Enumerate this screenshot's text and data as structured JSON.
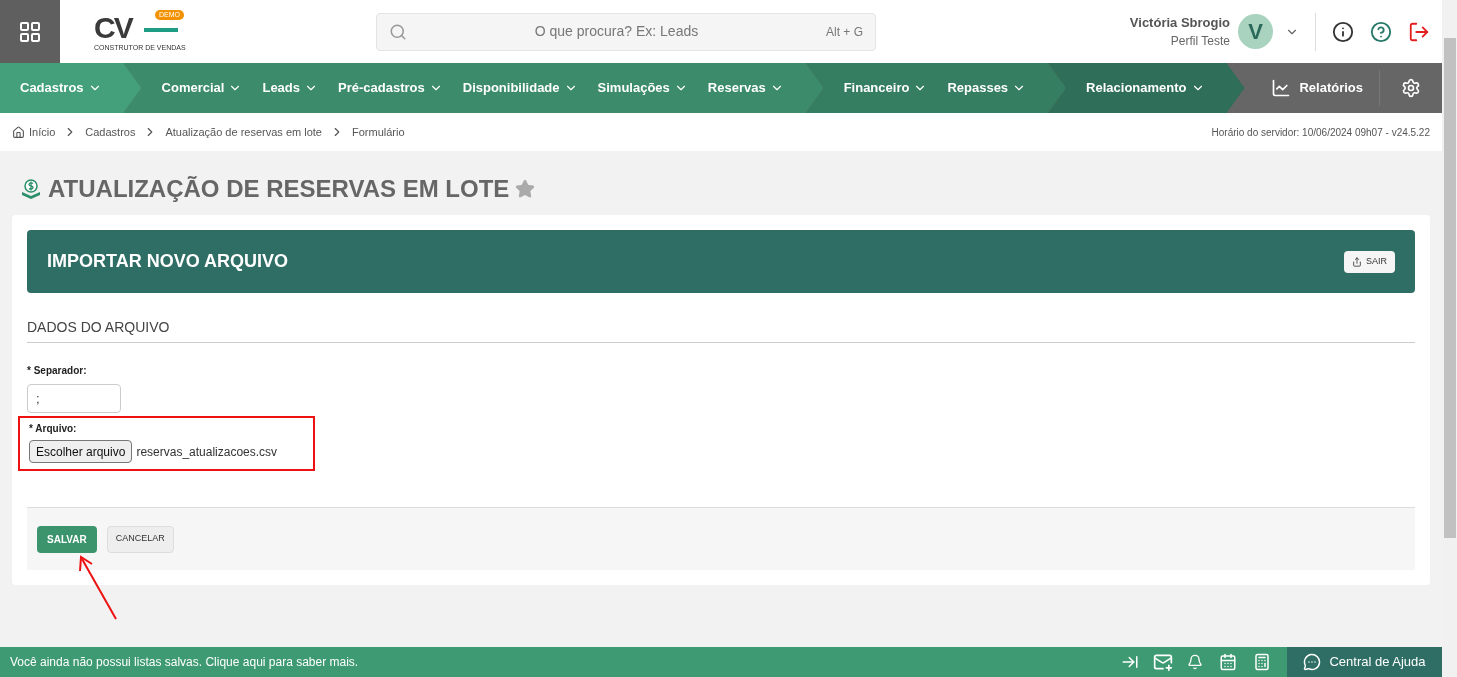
{
  "header": {
    "logo": {
      "text": "CV",
      "badge": "DEMO",
      "tagline": "CONSTRUTOR DE VENDAS"
    },
    "search": {
      "placeholder": "O que procura? Ex: Leads",
      "shortcut": "Alt + G"
    },
    "user": {
      "name": "Victória Sbrogio",
      "profile": "Perfil Teste",
      "initial": "V"
    }
  },
  "nav": {
    "groups": [
      {
        "color": "#43a07a",
        "items": [
          "Cadastros"
        ]
      },
      {
        "color": "#3c8c6b",
        "items": [
          "Comercial",
          "Leads",
          "Pré-cadastros",
          "Disponibilidade",
          "Simulações",
          "Reservas"
        ]
      },
      {
        "color": "#367e61",
        "items": [
          "Financeiro",
          "Repasses"
        ]
      },
      {
        "color": "#2f6e58",
        "items": [
          "Relacionamento"
        ]
      }
    ],
    "reports": "Relatórios"
  },
  "breadcrumb": [
    "Início",
    "Cadastros",
    "Atualização de reservas em lote",
    "Formulário"
  ],
  "server_time": "Horário do servidor: 10/06/2024 09h07 - v24.5.22",
  "page_title": "ATUALIZAÇÃO DE RESERVAS EM LOTE",
  "favorite": false,
  "panel": {
    "title": "IMPORTAR NOVO ARQUIVO",
    "exit": "SAIR"
  },
  "section": "DADOS DO ARQUIVO",
  "fields": [
    {
      "label": "* Separador:",
      "value": ";"
    },
    {
      "label": "* Arquivo:",
      "button": "Escolher arquivo",
      "file": "reservas_atualizacoes.csv",
      "highlighted": true
    }
  ],
  "actions": {
    "save": "SALVAR",
    "cancel": "CANCELAR"
  },
  "footer": {
    "message": "Você ainda não possui listas salvas. Clique aqui para saber mais.",
    "help": "Central de Ajuda"
  }
}
